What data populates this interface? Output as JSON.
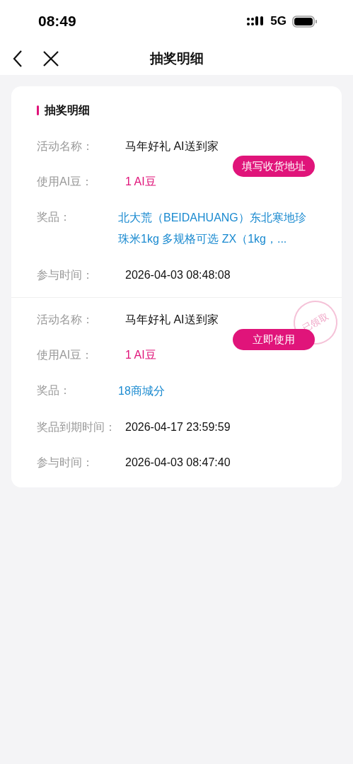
{
  "status_bar": {
    "time": "08:49",
    "network": "5G"
  },
  "nav": {
    "title": "抽奖明细"
  },
  "section_title": "抽奖明细",
  "records": [
    {
      "fields": [
        {
          "label": "活动名称：",
          "value": "马年好礼 AI送到家",
          "kind": "plain"
        },
        {
          "label": "使用AI豆：",
          "value": "1 AI豆",
          "kind": "beans"
        },
        {
          "label": "奖品：",
          "value": "北大荒（BEIDAHUANG）东北寒地珍珠米1kg 多规格可选 ZX（1kg，...",
          "kind": "prize"
        },
        {
          "label": "参与时间：",
          "value": "2026-04-03 08:48:08",
          "kind": "plain"
        }
      ],
      "action_button": "填写收货地址"
    },
    {
      "fields": [
        {
          "label": "活动名称：",
          "value": "马年好礼 AI送到家",
          "kind": "plain"
        },
        {
          "label": "使用AI豆：",
          "value": "1 AI豆",
          "kind": "beans"
        },
        {
          "label": "奖品：",
          "value": "18商城分",
          "kind": "prize"
        },
        {
          "label": "奖品到期时间：",
          "value": "2026-04-17 23:59:59",
          "kind": "plain"
        },
        {
          "label": "参与时间：",
          "value": "2026-04-03 08:47:40",
          "kind": "plain"
        }
      ],
      "action_button": "立即使用",
      "stamp": "已领取"
    }
  ]
}
